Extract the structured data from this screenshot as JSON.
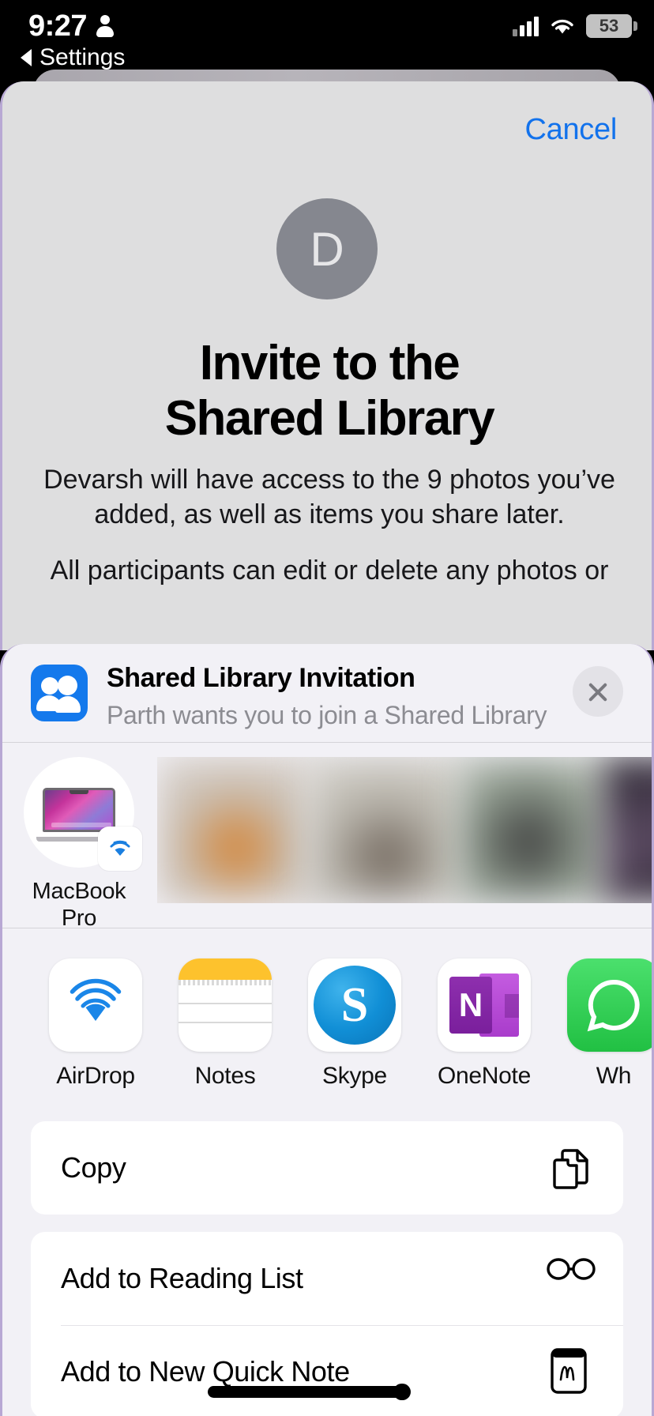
{
  "status_bar": {
    "time": "9:27",
    "person_icon": "person-icon",
    "signal_icon": "cellular-signal-icon",
    "wifi_icon": "wifi-icon",
    "battery_level": "53"
  },
  "nav": {
    "back_label": "Settings",
    "back_icon": "triangle-left-icon"
  },
  "invite_card": {
    "cancel_label": "Cancel",
    "avatar_initial": "D",
    "title_line1": "Invite to the",
    "title_line2": "Shared Library",
    "paragraph1": "Devarsh will have access to the 9 photos you’ve added, as well as items you share later.",
    "paragraph2": "All participants can edit or delete any photos or"
  },
  "share_sheet": {
    "header": {
      "icon": "shared-library-people-icon",
      "title": "Shared Library Invitation",
      "subtitle": "Parth wants you to join a Shared Library in…",
      "close_icon": "close-icon"
    },
    "airdrop": {
      "device_label_line1": "MacBook",
      "device_label_line2": "Pro",
      "device_icon": "macbook-pro-icon",
      "badge_icon": "airdrop-badge-icon"
    },
    "apps": [
      {
        "name": "AirDrop",
        "icon": "airdrop-icon"
      },
      {
        "name": "Notes",
        "icon": "notes-icon"
      },
      {
        "name": "Skype",
        "icon": "skype-icon",
        "glyph": "S"
      },
      {
        "name": "OneNote",
        "icon": "onenote-icon",
        "glyph": "N"
      },
      {
        "name": "Wh",
        "icon": "whatsapp-icon"
      }
    ],
    "actions": [
      {
        "label": "Copy",
        "icon": "copy-icon"
      },
      {
        "label": "Add to Reading List",
        "icon": "glasses-icon"
      },
      {
        "label": "Add to New Quick Note",
        "icon": "quick-note-icon"
      }
    ]
  },
  "colors": {
    "accent_blue": "#1272ec",
    "airdrop_blue": "#0b84ff",
    "sheet_bg": "#f2f1f6",
    "card_bg": "#dededf"
  }
}
